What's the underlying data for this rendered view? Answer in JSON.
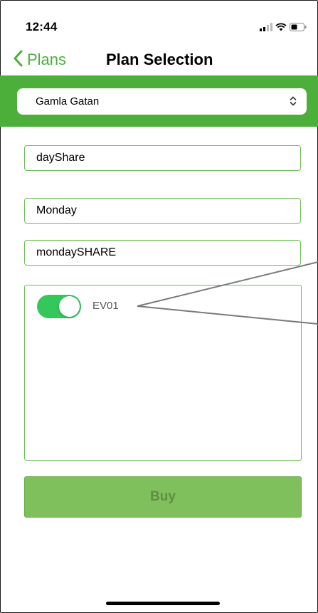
{
  "status_bar": {
    "time": "12:44",
    "icons": [
      "signal-icon",
      "wifi-icon",
      "battery-icon"
    ]
  },
  "nav": {
    "back_label": "Plans",
    "title": "Plan Selection"
  },
  "location_select": {
    "value": "Gamla Gatan",
    "icon": "chevron-up-down-icon"
  },
  "fields": {
    "plan_name": "dayShare",
    "day": "Monday",
    "schedule_name": "mondaySHARE"
  },
  "chargers": [
    {
      "label": "EV01",
      "enabled": true
    }
  ],
  "buy_label": "Buy",
  "colors": {
    "accent": "#4caf3a",
    "toggle_on": "#34c759",
    "buy_bg": "#7fbf5c",
    "buy_text": "#5e8f45",
    "field_border": "#6bbf55"
  }
}
